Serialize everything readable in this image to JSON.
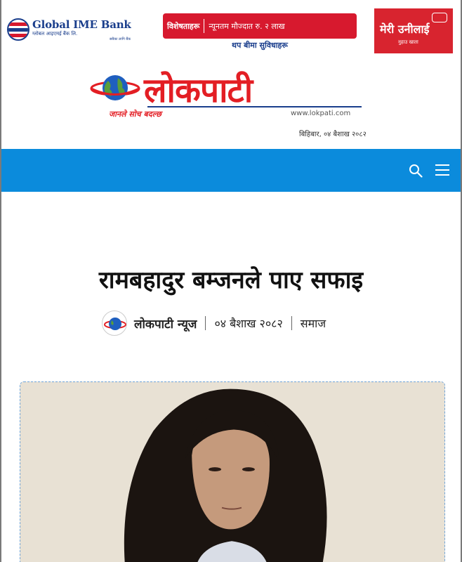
{
  "ads": {
    "global_ime": {
      "name": "Global IME Bank",
      "sub": "ग्लोबल आइएमई बैंक लि.",
      "tag": "सबैका लागि बैंक"
    },
    "mid_banner": {
      "label_1": "विशेषताहरू",
      "label_2": "न्यूनतम मौज्दात रु. २ लाख",
      "subline": "थप बीमा सुविधाहरू"
    },
    "meri": {
      "main": "मेरी उनीलाई",
      "sub": "नुहाउ खाता"
    }
  },
  "masthead": {
    "brand": "लोकपाटी",
    "tagline": "जानले सोच बदल्छ",
    "url": "www.lokpati.com",
    "date": "बिहिबार, ०४ बैशाख २०८२"
  },
  "nav": {
    "search_icon": "search-icon",
    "menu_icon": "hamburger-menu-icon",
    "color": "#0b8bdc"
  },
  "article": {
    "headline": "रामबहादुर बम्जनले पाए सफाइ",
    "author": "लोकपाटी न्यूज",
    "date": "०४ बैशाख २०८२",
    "category": "समाज"
  },
  "colors": {
    "brand_red": "#e31e24",
    "brand_blue": "#1a3e8c",
    "nav_blue": "#0b8bdc"
  }
}
